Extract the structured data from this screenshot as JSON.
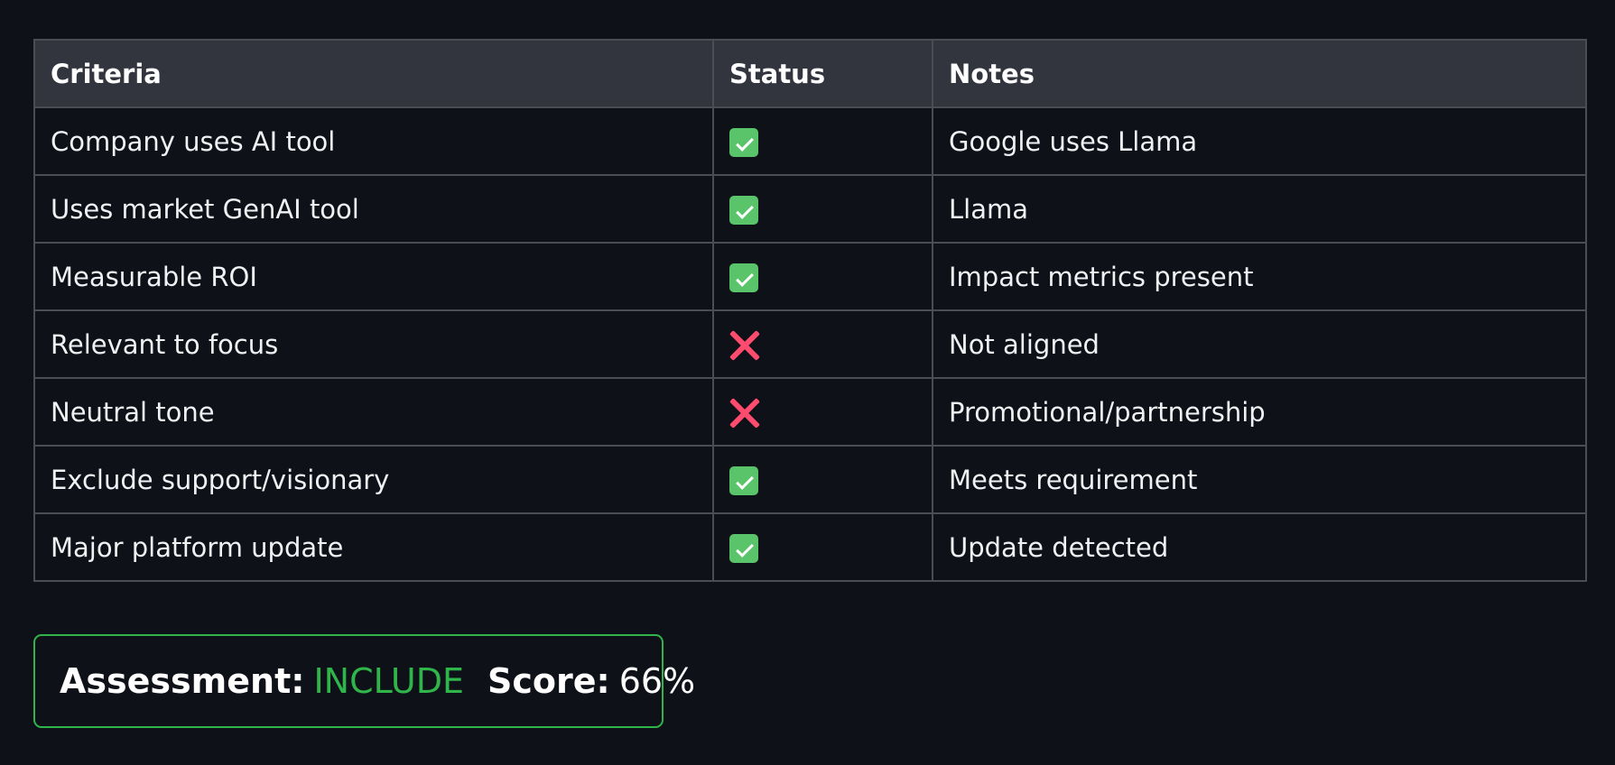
{
  "table": {
    "headers": {
      "criteria": "Criteria",
      "status": "Status",
      "notes": "Notes"
    },
    "rows": [
      {
        "criteria": "Company uses AI tool",
        "status": "pass",
        "status_icon": "check-mark-icon",
        "notes": "Google uses Llama"
      },
      {
        "criteria": "Uses market GenAI tool",
        "status": "pass",
        "status_icon": "check-mark-icon",
        "notes": "Llama"
      },
      {
        "criteria": "Measurable ROI",
        "status": "pass",
        "status_icon": "check-mark-icon",
        "notes": "Impact metrics present"
      },
      {
        "criteria": "Relevant to focus",
        "status": "fail",
        "status_icon": "cross-mark-icon",
        "notes": "Not aligned"
      },
      {
        "criteria": "Neutral tone",
        "status": "fail",
        "status_icon": "cross-mark-icon",
        "notes": "Promotional/partnership"
      },
      {
        "criteria": "Exclude support/visionary",
        "status": "pass",
        "status_icon": "check-mark-icon",
        "notes": "Meets requirement"
      },
      {
        "criteria": "Major platform update",
        "status": "pass",
        "status_icon": "check-mark-icon",
        "notes": "Update detected"
      }
    ]
  },
  "assessment": {
    "label": "Assessment:",
    "verdict": "INCLUDE",
    "score_label": "Score:",
    "score_value": "66%"
  },
  "colors": {
    "background": "#0e1118",
    "header_background": "#32343e",
    "border": "#4a4d54",
    "pass": "#5ac46a",
    "fail": "#ff4b6e",
    "verdict": "#2fb54a"
  }
}
